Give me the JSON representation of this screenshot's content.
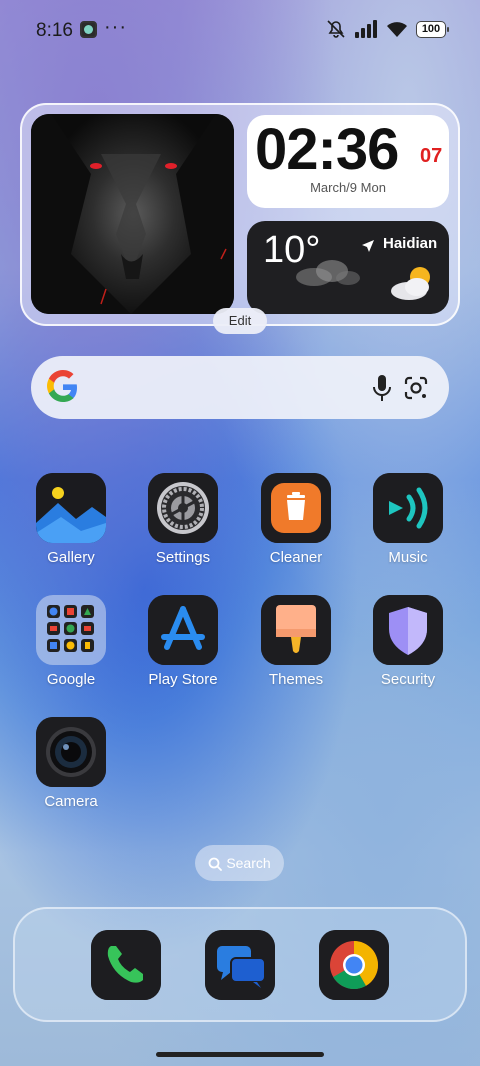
{
  "status_bar": {
    "time": "8:16",
    "dots": "···",
    "battery": "100"
  },
  "clock_widget": {
    "time": "02:36",
    "seconds": "07",
    "date": "March/9 Mon"
  },
  "weather_widget": {
    "temperature": "10°",
    "location": "Haidian"
  },
  "edit_label": "Edit",
  "apps": [
    {
      "label": "Gallery",
      "icon": "gallery-icon"
    },
    {
      "label": "Settings",
      "icon": "settings-gear-icon"
    },
    {
      "label": "Cleaner",
      "icon": "trash-icon"
    },
    {
      "label": "Music",
      "icon": "music-play-icon"
    },
    {
      "label": "Google",
      "icon": "folder-icon"
    },
    {
      "label": "Play Store",
      "icon": "app-store-icon"
    },
    {
      "label": "Themes",
      "icon": "paintbrush-icon"
    },
    {
      "label": "Security",
      "icon": "shield-icon"
    },
    {
      "label": "Camera",
      "icon": "camera-lens-icon"
    }
  ],
  "home_search_label": "Search",
  "dock": [
    {
      "icon": "phone-icon"
    },
    {
      "icon": "messages-icon"
    },
    {
      "icon": "chrome-icon"
    }
  ],
  "colors": {
    "accent_red": "#e02020",
    "music_teal": "#1ec6c0",
    "cleaner_orange": "#f07a2a",
    "play_blue": "#2a8cf0",
    "security_purple": "#9d8ff5"
  }
}
